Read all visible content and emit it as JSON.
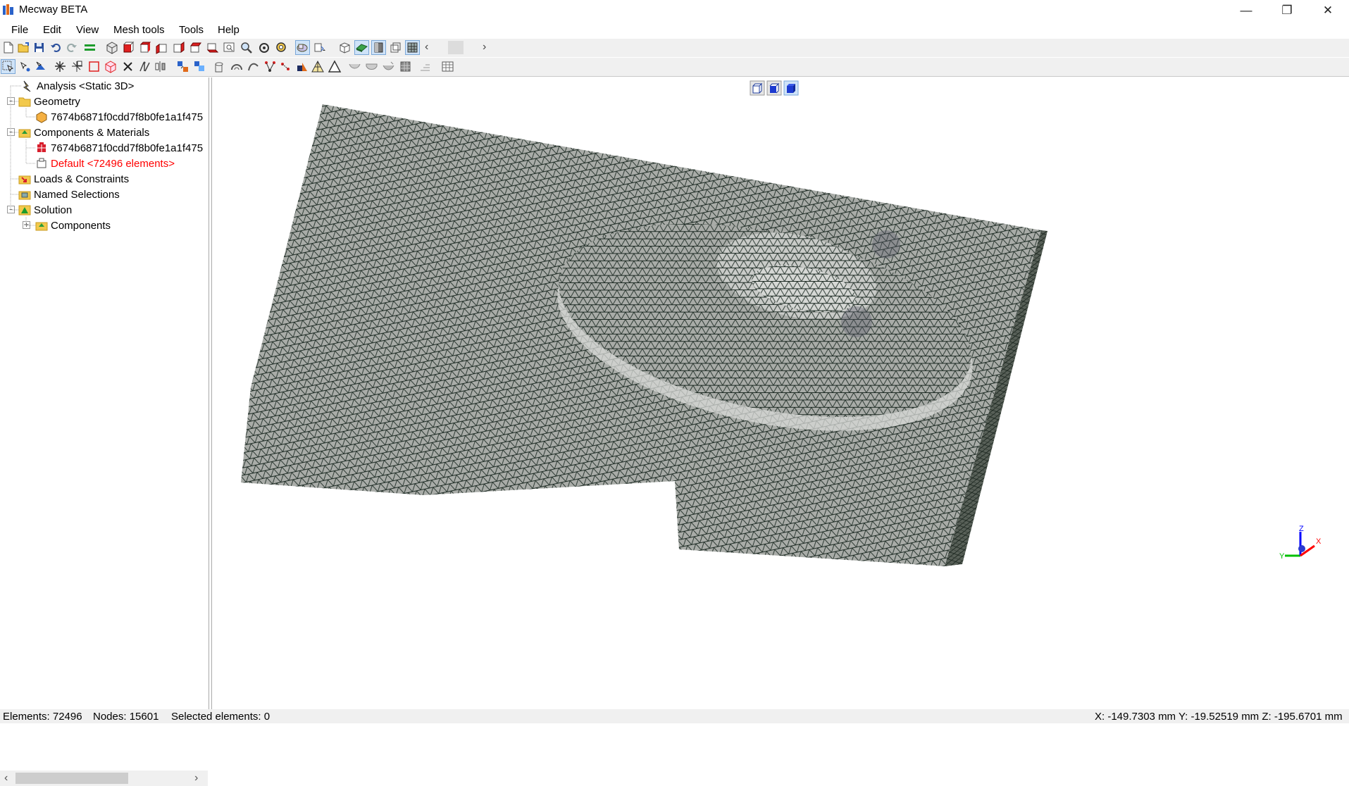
{
  "window": {
    "title": "Mecway BETA"
  },
  "menu": {
    "file": "File",
    "edit": "Edit",
    "view": "View",
    "mesh_tools": "Mesh tools",
    "tools": "Tools",
    "help": "Help"
  },
  "tree": {
    "analysis": "Analysis <Static 3D>",
    "geometry": "Geometry",
    "geometry_item": "7674b6871f0cdd7f8b0fe1a1f475",
    "components_materials": "Components & Materials",
    "component_item": "7674b6871f0cdd7f8b0fe1a1f475",
    "default_component": "Default <72496 elements>",
    "loads_constraints": "Loads & Constraints",
    "named_selections": "Named Selections",
    "solution": "Solution",
    "solution_components": "Components"
  },
  "colors": {
    "accent": "#ff0000",
    "mesh_fill": "#a9aca8",
    "mesh_line": "#1d2b24",
    "axis_x": "#ff0000",
    "axis_y": "#00c000",
    "axis_z": "#0000ff"
  },
  "axis": {
    "x": "X",
    "y": "Y",
    "z": "Z"
  },
  "status": {
    "elements": "Elements: 72496",
    "nodes": "Nodes: 15601",
    "selected": "Selected elements: 0",
    "coords": "X: -149.7303 mm Y: -19.52519 mm Z: -195.6701 mm"
  }
}
